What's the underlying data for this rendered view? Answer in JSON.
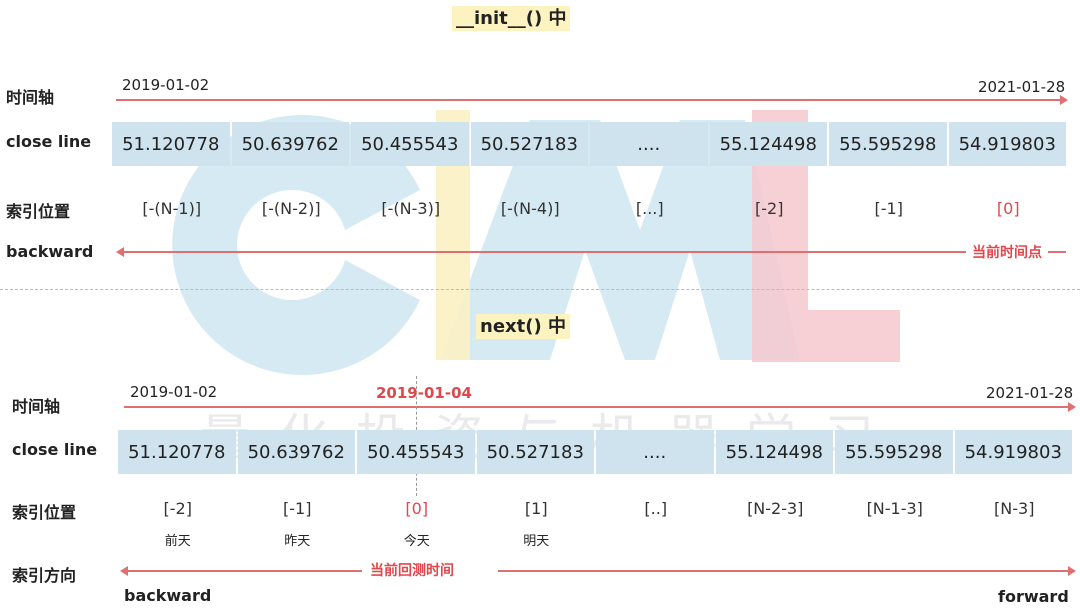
{
  "top": {
    "title": "__init__() 中",
    "timeline_label": "时间轴",
    "start_date": "2019-01-02",
    "end_date": "2021-01-28",
    "close_label": "close line",
    "values": [
      "51.120778",
      "50.639762",
      "50.455543",
      "50.527183",
      "....",
      "55.124498",
      "55.595298",
      "54.919803"
    ],
    "index_label": "索引位置",
    "indices": [
      "[-(N-1)]",
      "[-(N-2)]",
      "[-(N-3)]",
      "[-(N-4)]",
      "[...]",
      "[-2]",
      "[-1]",
      "[0]"
    ],
    "backward_label": "backward",
    "current_point_note": "当前时间点"
  },
  "bottom": {
    "title": "next() 中",
    "timeline_label": "时间轴",
    "start_date": "2019-01-02",
    "current_date": "2019-01-04",
    "end_date": "2021-01-28",
    "close_label": "close line",
    "values": [
      "51.120778",
      "50.639762",
      "50.455543",
      "50.527183",
      "....",
      "55.124498",
      "55.595298",
      "54.919803"
    ],
    "index_label": "索引位置",
    "indices": [
      "[-2]",
      "[-1]",
      "[0]",
      "[1]",
      "[..]",
      "[N-2-3]",
      "[N-1-3]",
      "[N-3]"
    ],
    "day_labels": [
      "前天",
      "昨天",
      "今天",
      "明天"
    ],
    "direction_label": "索引方向",
    "current_backtest_note": "当前回测时间",
    "backward_label": "backward",
    "forward_label": "forward"
  },
  "watermark": "量化投资与机器学习",
  "colors": {
    "accent_red": "#e0484c",
    "cell_blue": "#cfe3ee",
    "title_highlight": "#fdf3c0"
  }
}
